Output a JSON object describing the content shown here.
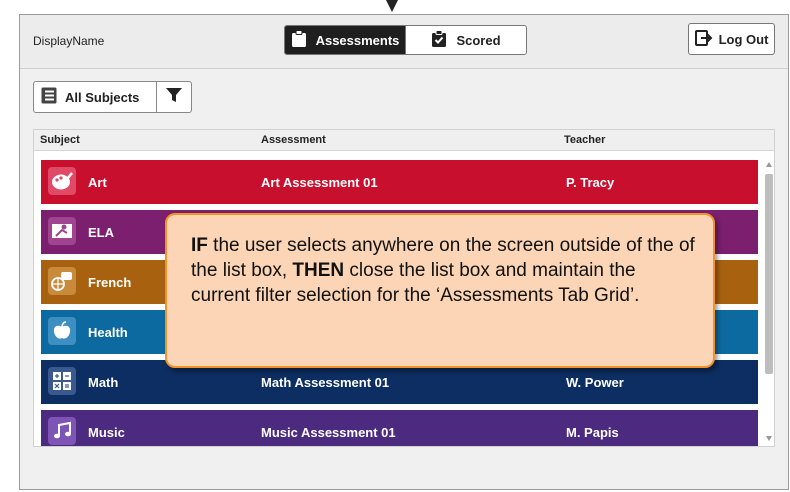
{
  "header": {
    "display_name": "DisplayName",
    "tabs": [
      {
        "label": "Assessments",
        "active": true
      },
      {
        "label": "Scored",
        "active": false
      }
    ],
    "logout_label": "Log Out"
  },
  "filter": {
    "subject_label": "All Subjects"
  },
  "grid": {
    "columns": [
      "Subject",
      "Assessment",
      "Teacher"
    ],
    "rows": [
      {
        "subject": "Art",
        "assessment": "Art Assessment 01",
        "teacher": "P. Tracy",
        "color": "#c8102e",
        "icon": "palette-icon"
      },
      {
        "subject": "ELA",
        "assessment": "",
        "teacher": "",
        "color": "#7b1f6e",
        "icon": "reading-icon"
      },
      {
        "subject": "French",
        "assessment": "",
        "teacher": "",
        "color": "#a8620f",
        "icon": "globe-chat-icon"
      },
      {
        "subject": "Health",
        "assessment": "",
        "teacher": "",
        "color": "#0d6aa0",
        "icon": "apple-icon"
      },
      {
        "subject": "Math",
        "assessment": "Math Assessment 01",
        "teacher": "W. Power",
        "color": "#0d2e63",
        "icon": "calculator-icon"
      },
      {
        "subject": "Music",
        "assessment": "Music Assessment 01",
        "teacher": "M. Papis",
        "color": "#4b2a80",
        "icon": "music-note-icon"
      }
    ]
  },
  "callout": {
    "if_word": "IF",
    "text_1": " the user selects anywhere on the screen outside of the of the list box, ",
    "then_word": "THEN",
    "text_2": " close the list box and maintain the current filter selection for the ‘Assessments Tab Grid’."
  }
}
